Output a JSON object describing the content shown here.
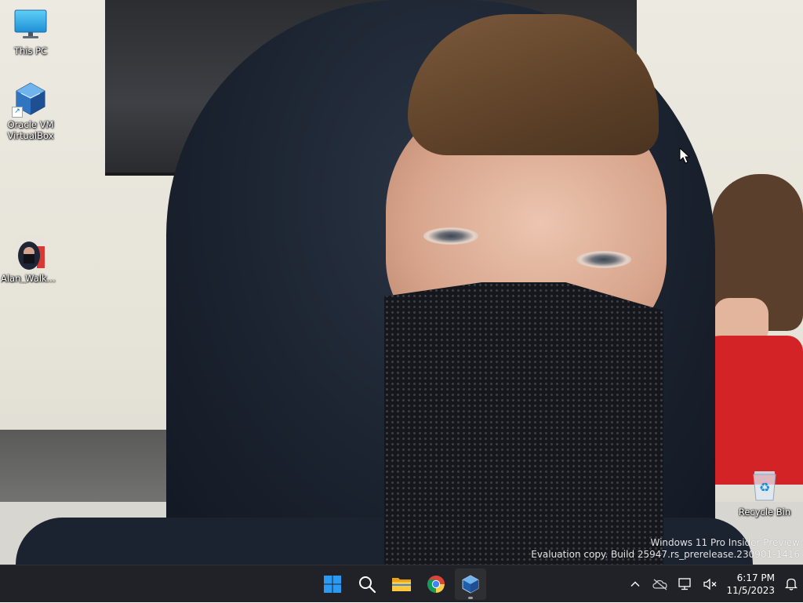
{
  "desktop": {
    "icons": [
      {
        "label": "This PC",
        "icon": "monitor-icon"
      },
      {
        "label": "Oracle VM VirtualBox",
        "icon": "virtualbox-icon"
      },
      {
        "label": "Alan_Walker...",
        "icon": "image-thumbnail-icon"
      },
      {
        "label": "Recycle Bin",
        "icon": "recycle-bin-icon"
      }
    ],
    "watermark": {
      "line1": "Windows 11 Pro Insider Preview",
      "line2": "Evaluation copy. Build 25947.rs_prerelease.230901-1416"
    }
  },
  "taskbar": {
    "apps": [
      {
        "name": "Start",
        "icon": "windows-logo-icon"
      },
      {
        "name": "Search",
        "icon": "search-icon"
      },
      {
        "name": "File Explorer",
        "icon": "folder-icon"
      },
      {
        "name": "Google Chrome",
        "icon": "chrome-icon"
      },
      {
        "name": "Oracle VM VirtualBox",
        "icon": "virtualbox-icon",
        "running": true
      }
    ],
    "tray": {
      "icons": [
        "chevron-up-icon",
        "onedrive-offline-icon",
        "network-icon",
        "volume-muted-icon"
      ],
      "time": "6:17 PM",
      "date": "11/5/2023",
      "notification_icon": "bell-icon"
    }
  },
  "colors": {
    "taskbar_bg": "#202227",
    "accent_blue": "#0078d4",
    "label_text": "#ffffff"
  }
}
